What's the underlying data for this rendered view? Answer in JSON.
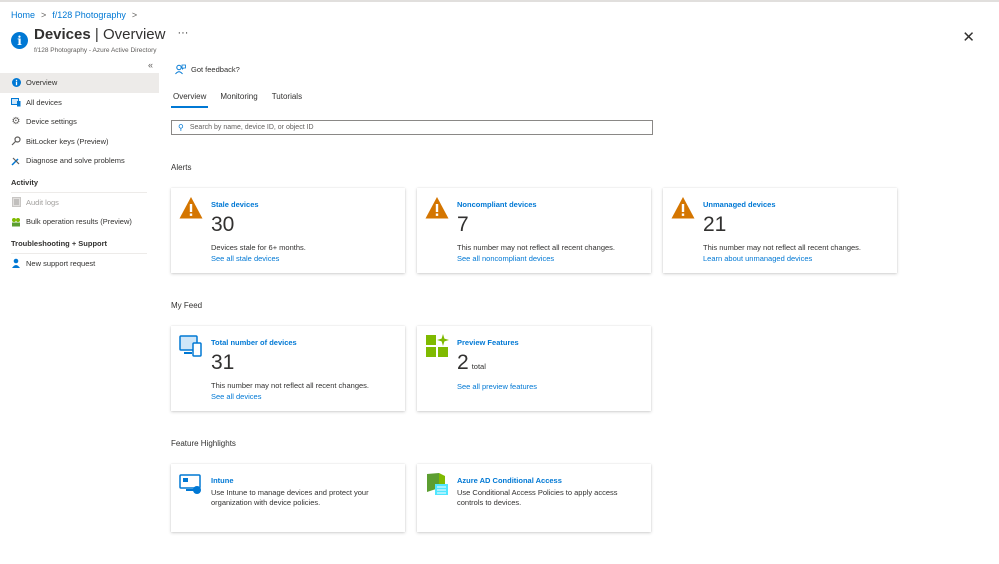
{
  "breadcrumb": {
    "home": "Home",
    "org": "f/128 Photography"
  },
  "header": {
    "title_bold": "Devices",
    "title_rest": " | Overview",
    "subtitle": "f/128 Photography - Azure Active Directory",
    "more": "···",
    "close": "✕"
  },
  "sidebar": {
    "collapse": "«",
    "items": [
      {
        "label": "Overview"
      },
      {
        "label": "All devices"
      },
      {
        "label": "Device settings"
      },
      {
        "label": "BitLocker keys (Preview)"
      },
      {
        "label": "Diagnose and solve problems"
      }
    ],
    "activity_title": "Activity",
    "activity_items": [
      {
        "label": "Audit logs"
      },
      {
        "label": "Bulk operation results (Preview)"
      }
    ],
    "support_title": "Troubleshooting + Support",
    "support_items": [
      {
        "label": "New support request"
      }
    ]
  },
  "main": {
    "feedback": "Got feedback?",
    "tabs": [
      {
        "label": "Overview"
      },
      {
        "label": "Monitoring"
      },
      {
        "label": "Tutorials"
      }
    ],
    "search_placeholder": "Search by name, device ID, or object ID",
    "alerts_title": "Alerts",
    "alerts": [
      {
        "title": "Stale devices",
        "value": "30",
        "desc": "Devices stale for 6+ months.",
        "link": "See all stale devices"
      },
      {
        "title": "Noncompliant devices",
        "value": "7",
        "desc": "This number may not reflect all recent changes.",
        "link": "See all noncompliant devices"
      },
      {
        "title": "Unmanaged devices",
        "value": "21",
        "desc": "This number may not reflect all recent changes.",
        "link": "Learn about unmanaged devices"
      }
    ],
    "feed_title": "My Feed",
    "feed": [
      {
        "title": "Total number of devices",
        "value": "31",
        "desc": "This number may not reflect all recent changes.",
        "link": "See all devices"
      },
      {
        "title": "Preview Features",
        "value": "2",
        "unit": "total",
        "link": "See all preview features"
      }
    ],
    "highlights_title": "Feature Highlights",
    "highlights": [
      {
        "title": "Intune",
        "desc_line1": "Use Intune to manage devices and protect your",
        "desc_line2": "organization with device policies."
      },
      {
        "title": "Azure AD Conditional Access",
        "desc_line1": "Use Conditional Access Policies to apply access",
        "desc_line2": "controls to devices."
      }
    ]
  },
  "colors": {
    "accent": "#0078d4",
    "warning": "#d47500",
    "green": "#7fba00"
  }
}
